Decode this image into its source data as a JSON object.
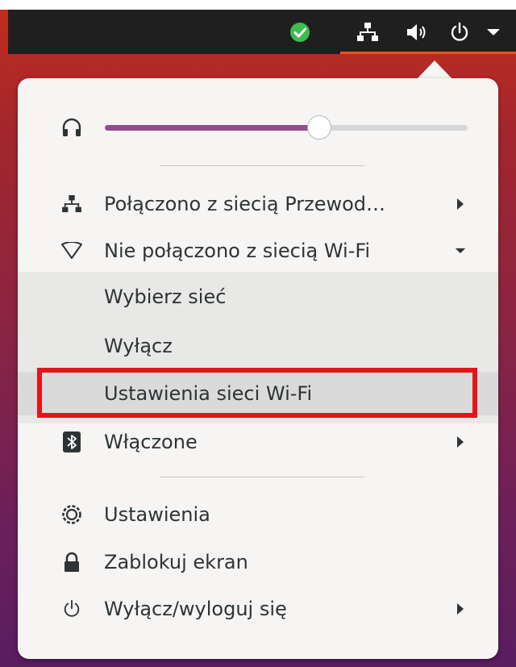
{
  "topbar": {
    "icons": [
      "check-status-icon",
      "wired-network-icon",
      "volume-icon",
      "power-icon",
      "dropdown-arrow-icon"
    ],
    "accent_color": "#e95420",
    "status_color": "#3cbd4f"
  },
  "volume": {
    "icon": "headphones-icon",
    "level": 0.59,
    "fill_color": "#924d8b"
  },
  "menu": {
    "wired": {
      "label": "Połączono z siecią Przewod…",
      "icon": "wired-network-icon"
    },
    "wifi": {
      "label": "Nie połączono z siecią Wi-Fi",
      "icon": "wifi-empty-icon"
    },
    "wifi_items": [
      {
        "label": "Wybierz sieć"
      },
      {
        "label": "Wyłącz"
      },
      {
        "label": "Ustawienia sieci Wi-Fi"
      }
    ],
    "bluetooth": {
      "label": "Włączone",
      "icon": "bluetooth-icon"
    },
    "settings": {
      "label": "Ustawienia",
      "icon": "settings-gear-icon"
    },
    "lock": {
      "label": "Zablokuj ekran",
      "icon": "lock-icon"
    },
    "power": {
      "label": "Wyłącz/wyloguj się",
      "icon": "power-icon"
    }
  },
  "highlight_color": "#e3151b"
}
